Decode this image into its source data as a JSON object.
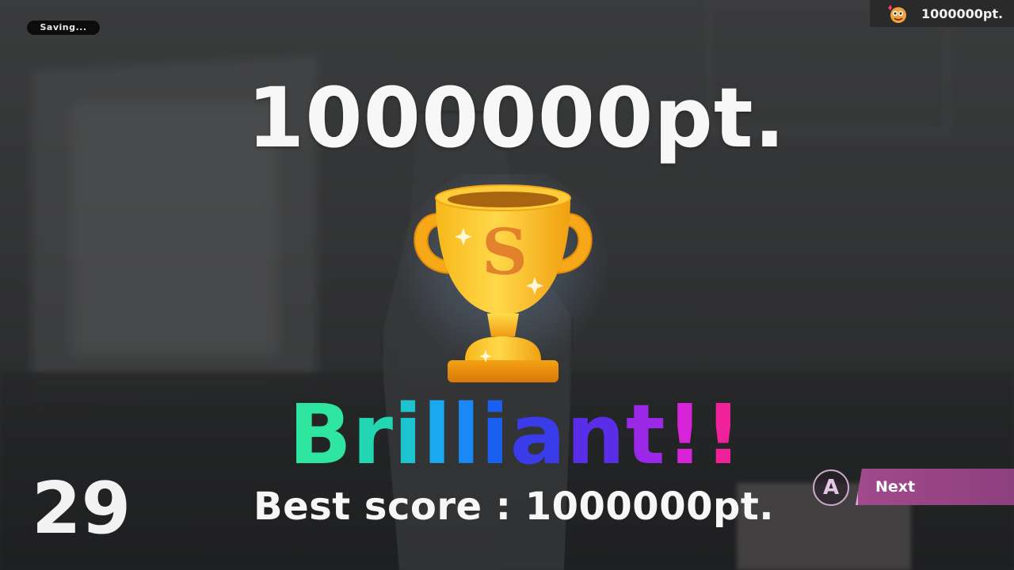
{
  "hud": {
    "saving_label": "Saving...",
    "top_score": "1000000pt."
  },
  "result": {
    "score": "1000000pt.",
    "rank_letter": "S",
    "rank_word_letters": [
      {
        "ch": "B",
        "color": "#2fe6a0"
      },
      {
        "ch": "r",
        "color": "#22d6b4"
      },
      {
        "ch": "i",
        "color": "#1cc4d0"
      },
      {
        "ch": "l",
        "color": "#1aa8ee"
      },
      {
        "ch": "l",
        "color": "#1a88f6"
      },
      {
        "ch": "i",
        "color": "#1a60f0"
      },
      {
        "ch": "a",
        "color": "#3a3cea"
      },
      {
        "ch": "n",
        "color": "#5a2ee8"
      },
      {
        "ch": "t",
        "color": "#9a28e6"
      },
      {
        "ch": "!",
        "color": "#d824d8"
      },
      {
        "ch": "!",
        "color": "#f0229a"
      }
    ],
    "best_score_text": "Best score : 1000000pt."
  },
  "counter": "29",
  "controls": {
    "button_glyph": "A",
    "next_label": "Next",
    "accent_color": "#a04a8c"
  },
  "icons": {
    "trophy": "trophy-icon",
    "face": "face-icon"
  }
}
